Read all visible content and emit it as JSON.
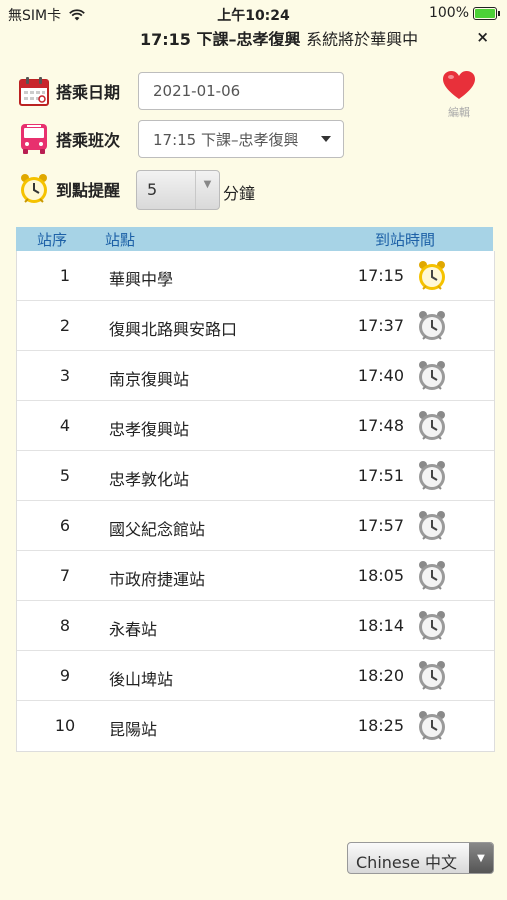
{
  "status_bar": {
    "carrier": "無SIM卡",
    "time": "上午10:24",
    "battery": "100%"
  },
  "marquee": {
    "bold": "17:15 下課–忠孝復興",
    "normal": "系統將於華興中",
    "close": "×"
  },
  "form": {
    "date_label": "搭乘日期",
    "date_value": "2021-01-06",
    "route_label": "搭乘班次",
    "route_value": "17:15 下課–忠孝復興",
    "reminder_label": "到點提醒",
    "reminder_value": "5",
    "reminder_unit": "分鐘"
  },
  "favorite": {
    "label": "編輯"
  },
  "table": {
    "headers": {
      "no": "站序",
      "stop": "站點",
      "time": "到站時間"
    },
    "rows": [
      {
        "no": "1",
        "stop": "華興中學",
        "time": "17:15",
        "alarm_active": true
      },
      {
        "no": "2",
        "stop": "復興北路興安路口",
        "time": "17:37",
        "alarm_active": false
      },
      {
        "no": "3",
        "stop": "南京復興站",
        "time": "17:40",
        "alarm_active": false
      },
      {
        "no": "4",
        "stop": "忠孝復興站",
        "time": "17:48",
        "alarm_active": false
      },
      {
        "no": "5",
        "stop": "忠孝敦化站",
        "time": "17:51",
        "alarm_active": false
      },
      {
        "no": "6",
        "stop": "國父紀念館站",
        "time": "17:57",
        "alarm_active": false
      },
      {
        "no": "7",
        "stop": "市政府捷運站",
        "time": "18:05",
        "alarm_active": false
      },
      {
        "no": "8",
        "stop": "永春站",
        "time": "18:14",
        "alarm_active": false
      },
      {
        "no": "9",
        "stop": "後山埤站",
        "time": "18:20",
        "alarm_active": false
      },
      {
        "no": "10",
        "stop": "昆陽站",
        "time": "18:25",
        "alarm_active": false
      }
    ]
  },
  "language": {
    "value": "Chinese 中文"
  },
  "colors": {
    "background": "#fdfbe6",
    "table_header": "#a7d3e6",
    "header_text": "#1d61a7",
    "heart": "#e8303a",
    "alarm_active": "#f5c200",
    "alarm_inactive": "#9a9a9a"
  },
  "icons": {
    "calendar": "calendar-icon",
    "bus": "bus-icon",
    "alarm": "alarm-clock-icon",
    "heart": "heart-icon",
    "wifi": "wifi-icon"
  }
}
